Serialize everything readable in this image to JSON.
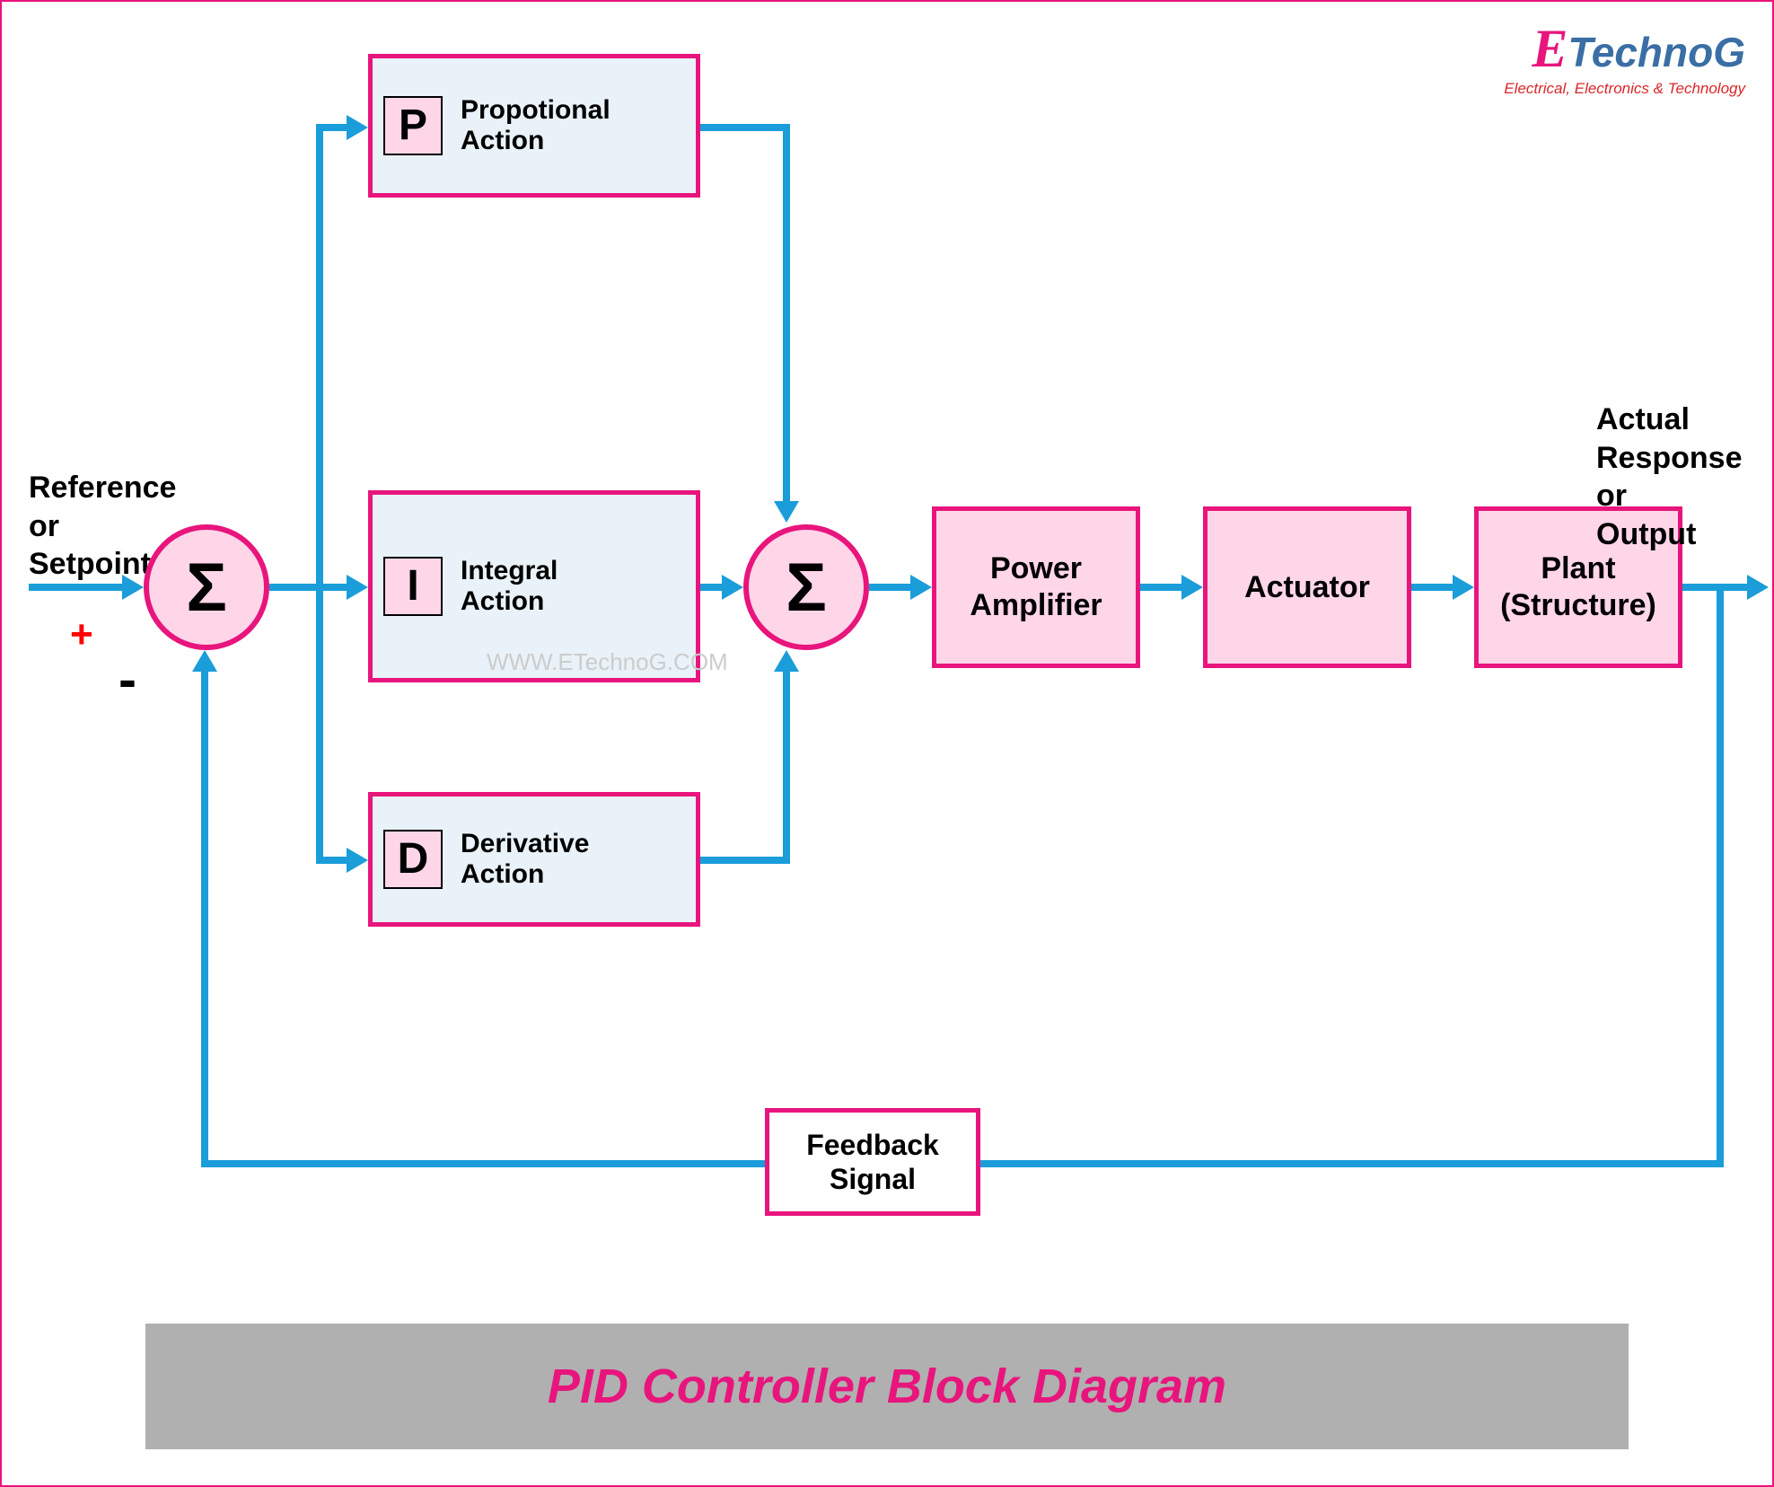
{
  "logo": {
    "e": "E",
    "main": "TechnoG",
    "sub": "Electrical, Electronics & Technology"
  },
  "labels": {
    "input": "Reference\nor\nSetpoint",
    "output": "Actual\nResponse\nor\nOutput",
    "plus": "+",
    "minus": "-"
  },
  "sum1": "Σ",
  "sum2": "Σ",
  "blocks": {
    "p": {
      "letter": "P",
      "text": "Propotional\nAction"
    },
    "i": {
      "letter": "I",
      "text": "Integral\nAction"
    },
    "d": {
      "letter": "D",
      "text": "Derivative\nAction"
    },
    "amp": "Power\nAmplifier",
    "actuator": "Actuator",
    "plant": "Plant\n(Structure)",
    "feedback": "Feedback\nSignal"
  },
  "watermark": "WWW.ETechnoG.COM",
  "title": "PID Controller Block Diagram"
}
